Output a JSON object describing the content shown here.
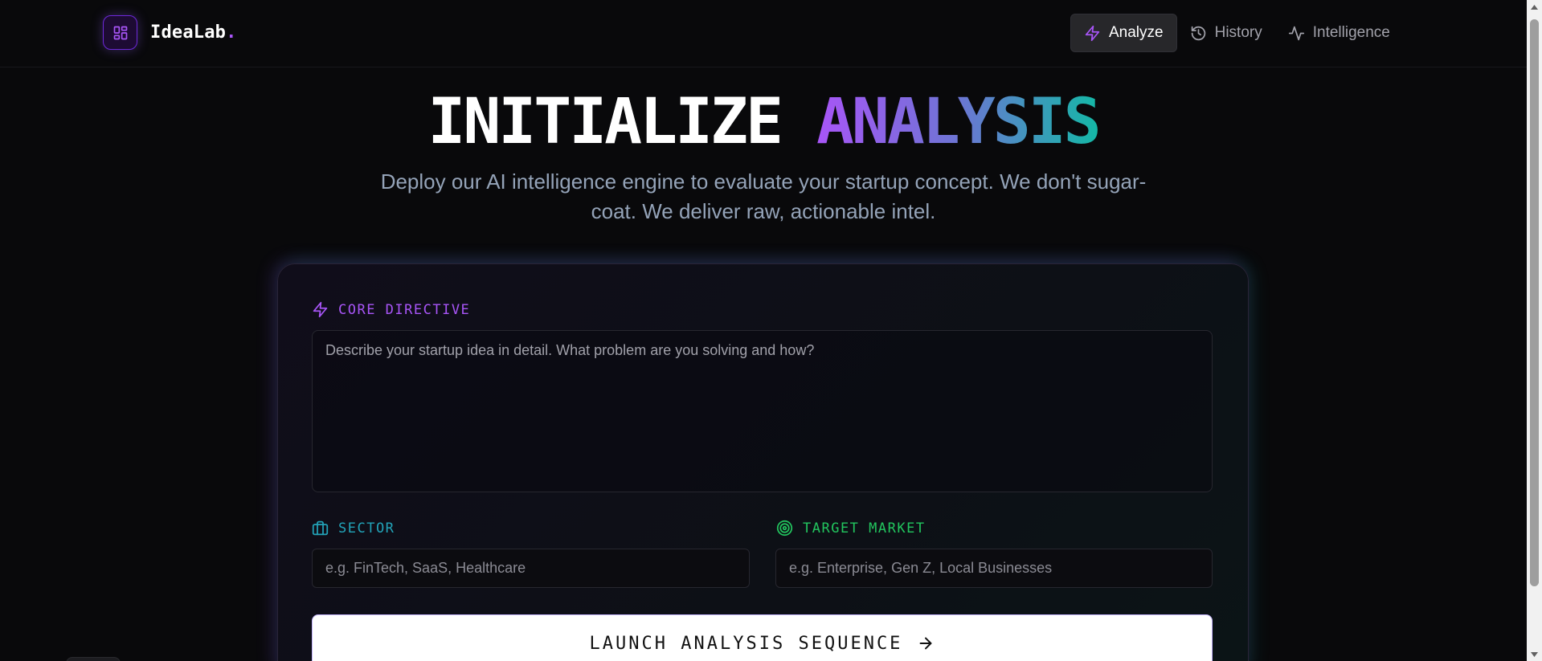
{
  "header": {
    "brand": {
      "name": "IdeaLab",
      "dot": "."
    },
    "nav": [
      {
        "label": "Analyze",
        "icon": "zap-icon",
        "active": true
      },
      {
        "label": "History",
        "icon": "history-icon",
        "active": false
      },
      {
        "label": "Intelligence",
        "icon": "activity-icon",
        "active": false
      }
    ]
  },
  "hero": {
    "title_main": "INITIALIZE",
    "title_accent": "ANALYSIS",
    "subtitle": "Deploy our AI intelligence engine to evaluate your startup concept. We don't sugar-coat. We deliver raw, actionable intel."
  },
  "form": {
    "core": {
      "label": "CORE DIRECTIVE",
      "icon": "zap-icon",
      "placeholder": "Describe your startup idea in detail. What problem are you solving and how?"
    },
    "sector": {
      "label": "SECTOR",
      "icon": "briefcase-icon",
      "placeholder": "e.g. FinTech, SaaS, Healthcare"
    },
    "target": {
      "label": "TARGET MARKET",
      "icon": "target-icon",
      "placeholder": "e.g. Enterprise, Gen Z, Local Businesses"
    },
    "submit_label": "LAUNCH ANALYSIS SEQUENCE"
  },
  "colors": {
    "accent_purple": "#a855f7",
    "accent_teal": "#14b8a6",
    "accent_green": "#22c55e",
    "background": "#09090b"
  }
}
